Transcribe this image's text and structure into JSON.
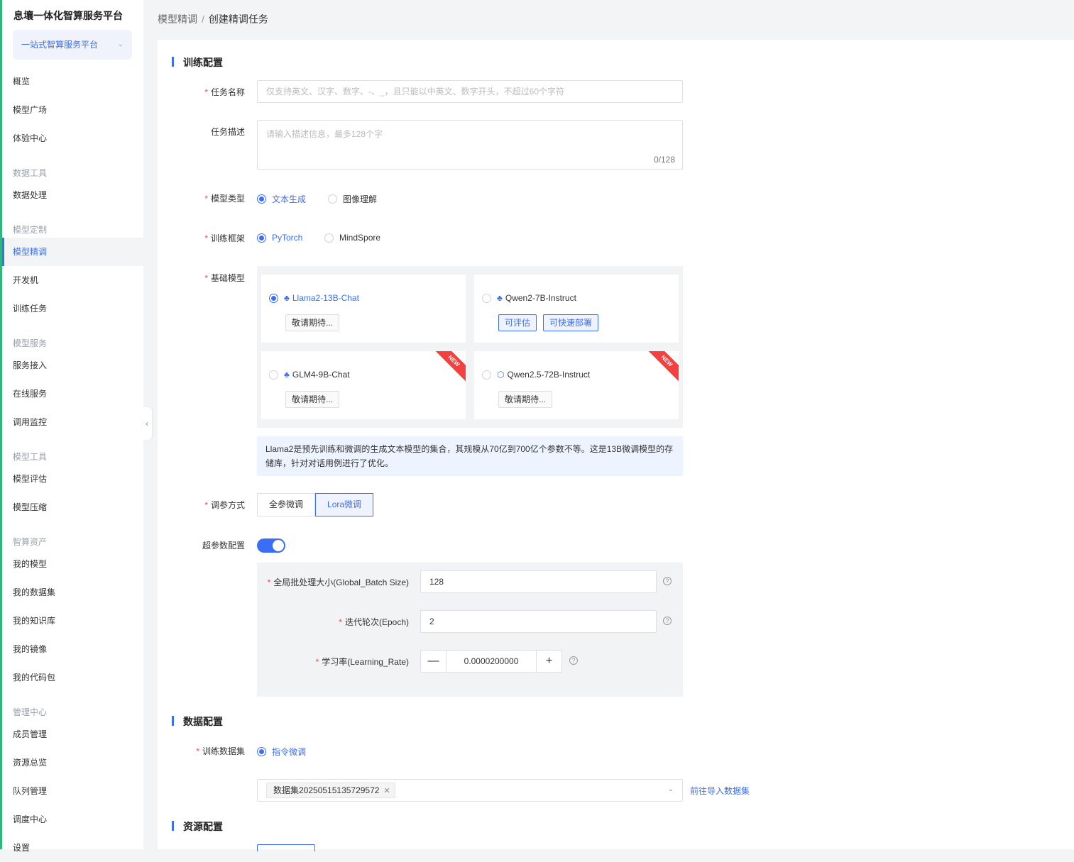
{
  "sidebar": {
    "title": "息壤一体化智算服务平台",
    "platform_select": "一站式智算服务平台",
    "items": {
      "overview": "概览",
      "model_square": "模型广场",
      "experience": "体验中心",
      "data_processing": "数据处理",
      "fine_tuning": "模型精调",
      "dev_machine": "开发机",
      "train_task": "训练任务",
      "service_access": "服务接入",
      "online_service": "在线服务",
      "call_monitor": "调用监控",
      "model_eval": "模型评估",
      "model_compress": "模型压缩",
      "my_models": "我的模型",
      "my_datasets": "我的数据集",
      "my_kb": "我的知识库",
      "my_images": "我的镜像",
      "my_code": "我的代码包",
      "members": "成员管理",
      "resources": "资源总览",
      "queues": "队列管理",
      "scheduler": "调度中心",
      "settings": "设置"
    },
    "groups": {
      "data_tools": "数据工具",
      "model_custom": "模型定制",
      "model_service": "模型服务",
      "model_tools": "模型工具",
      "assets": "智算资产",
      "admin": "管理中心"
    }
  },
  "breadcrumb": {
    "parent": "模型精调",
    "sep": "/",
    "current": "创建精调任务"
  },
  "train_config": {
    "title": "训练配置",
    "task_name_label": "任务名称",
    "task_name_placeholder": "仅支持英文、汉字、数字、-、_，且只能以中英文、数字开头，不超过60个字符",
    "task_desc_label": "任务描述",
    "task_desc_placeholder": "请输入描述信息，最多128个字",
    "task_desc_count": "0/128",
    "model_type_label": "模型类型",
    "model_type_opts": [
      "文本生成",
      "图像理解"
    ],
    "framework_label": "训练框架",
    "framework_opts": [
      "PyTorch",
      "MindSpore"
    ],
    "base_model_label": "基础模型",
    "models": [
      {
        "name": "Llama2-13B-Chat",
        "tags": [
          "敬请期待..."
        ],
        "selected": true
      },
      {
        "name": "Qwen2-7B-Instruct",
        "tags": [
          "可评估",
          "可快速部署"
        ]
      },
      {
        "name": "GLM4-9B-Chat",
        "tags": [
          "敬请期待..."
        ],
        "ribbon": "NEW"
      },
      {
        "name": "Qwen2.5-72B-Instruct",
        "tags": [
          "敬请期待..."
        ],
        "ribbon": "NEW"
      }
    ],
    "model_desc": "Llama2是预先训练和微调的生成文本模型的集合，其规模从70亿到700亿个参数不等。这是13B微调模型的存储库，针对对话用例进行了优化。",
    "tune_label": "调参方式",
    "tune_opts": [
      "全参微调",
      "Lora微调"
    ],
    "hyper_label": "超参数配置",
    "batch_label": "全局批处理大小(Global_Batch Size)",
    "batch_value": "128",
    "epoch_label": "迭代轮次(Epoch)",
    "epoch_value": "2",
    "lr_label": "学习率(Learning_Rate)",
    "lr_value": "0.0000200000",
    "help": "?"
  },
  "data_config": {
    "title": "数据配置",
    "dataset_label": "训练数据集",
    "dataset_type": "指令微调",
    "dataset_tag": "数据集20250515135729572",
    "import_link": "前往导入数据集"
  },
  "resource_config": {
    "title": "资源配置"
  },
  "colors": {
    "accent": "#3a6ef6",
    "required": "#f04848",
    "ribbon": "#f54040"
  },
  "icons": {
    "collapse": "chevron-left-icon",
    "dropdown": "chevron-down-icon",
    "model": "model-logo-icon"
  }
}
